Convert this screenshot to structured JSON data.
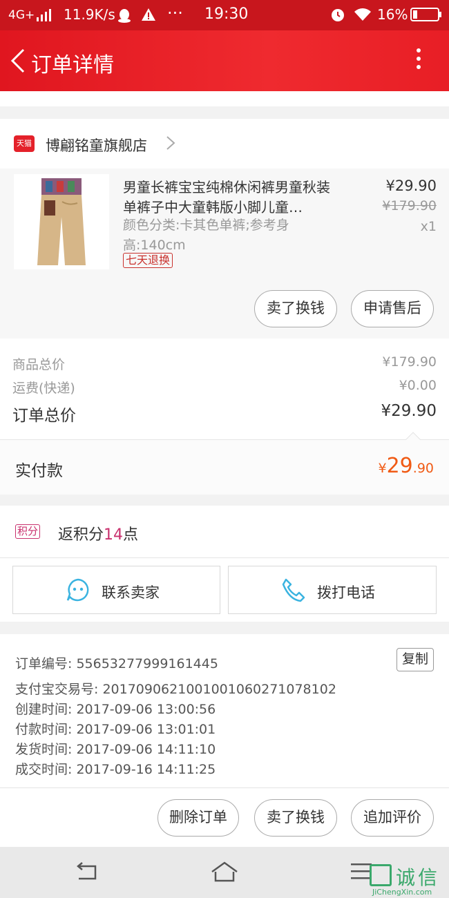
{
  "status_bar": {
    "network": "4G+",
    "speed": "11.9K/s",
    "more": "···",
    "time": "19:30",
    "battery": "16%"
  },
  "header": {
    "title": "订单详情"
  },
  "store": {
    "badge": "天猫",
    "name": "博翩铭童旗舰店"
  },
  "product": {
    "title": "男童长裤宝宝纯棉休闲裤男童秋装单裤子中大童韩版小脚儿童…",
    "spec": "颜色分类:卡其色单裤;参考身高:140cm",
    "tag": "七天退换",
    "price": "¥29.90",
    "original_price": "¥179.90",
    "quantity": "x1",
    "buttons": [
      "卖了换钱",
      "申请售后"
    ]
  },
  "summary": {
    "goods_total_label": "商品总价",
    "goods_total": "¥179.90",
    "shipping_label": "运费(快递)",
    "shipping": "¥0.00",
    "order_total_label": "订单总价",
    "order_total": "¥29.90"
  },
  "paid": {
    "label": "实付款",
    "currency": "¥",
    "integer": "29",
    "decimal": ".90"
  },
  "points": {
    "badge": "积分",
    "prefix": "返积分",
    "value": "14",
    "suffix": "点"
  },
  "contact": {
    "seller": "联系卖家",
    "phone": "拨打电话"
  },
  "order_info": {
    "copy": "复制",
    "rows": [
      "订单编号: 55653277999161445",
      "支付宝交易号: 2017090621001001060271078102",
      "创建时间: 2017-09-06 13:00:56",
      "付款时间: 2017-09-06 13:01:01",
      "发货时间: 2017-09-06 14:11:10",
      "成交时间: 2017-09-16 14:11:25"
    ]
  },
  "actions": [
    "删除订单",
    "卖了换钱",
    "追加评价"
  ],
  "watermark": {
    "text": "诚信",
    "url": "JiChengXin.com"
  },
  "colors": {
    "header": "#e0161f",
    "accent_price": "#f05a14",
    "points": "#c9306d"
  }
}
